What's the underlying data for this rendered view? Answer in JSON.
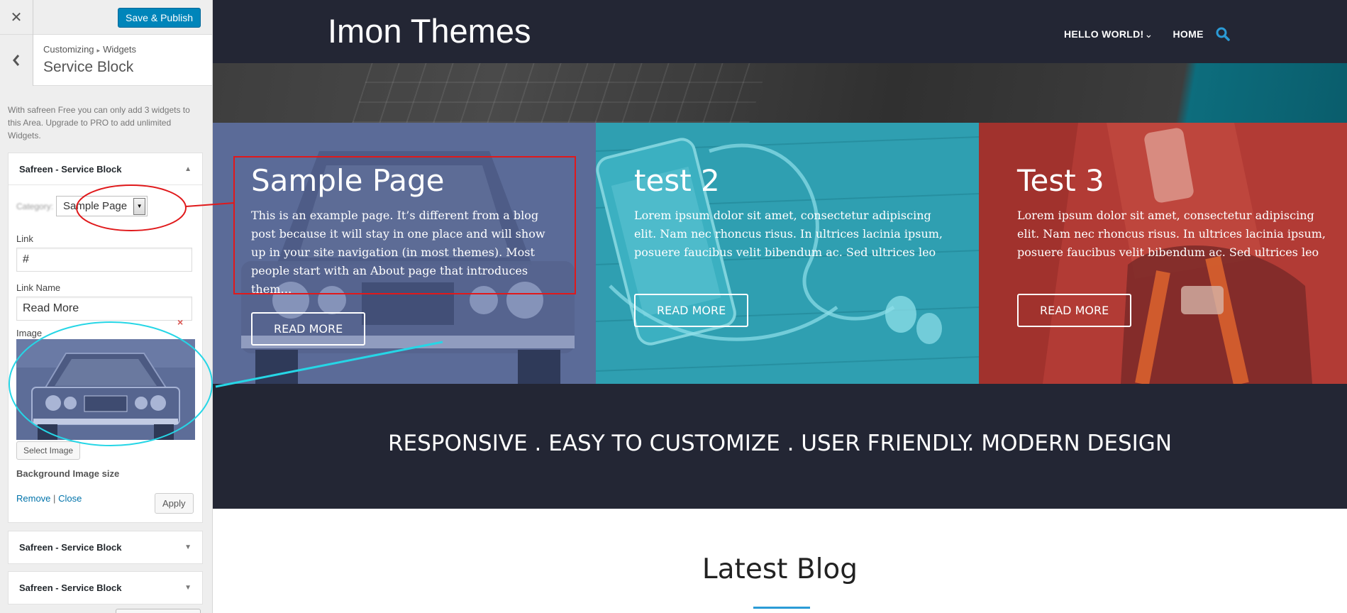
{
  "customizer": {
    "close_glyph": "✕",
    "save_publish": "Save & Publish",
    "back_glyph": "‹",
    "breadcrumb": {
      "root": "Customizing",
      "separator": "▸",
      "parent": "Widgets"
    },
    "section_title": "Service Block",
    "notice": "With safreen Free you can only add 3 widgets to this Area. Upgrade to PRO to add unlimited Widgets.",
    "widgets": [
      {
        "title": "Safreen - Service Block",
        "expanded": true
      },
      {
        "title": "Safreen - Service Block",
        "expanded": false
      },
      {
        "title": "Safreen - Service Block",
        "expanded": false
      }
    ],
    "form": {
      "category_label": "Category:",
      "category_value": "Sample Page",
      "link_label": "Link",
      "link_value": "#",
      "link_name_label": "Link Name",
      "link_name_value": "Read More",
      "image_label": "Image",
      "image_remove_glyph": "×",
      "select_image": "Select Image",
      "bg_size_label": "Background Image size",
      "remove": "Remove",
      "link_sep": "|",
      "close": "Close",
      "apply": "Apply"
    }
  },
  "site": {
    "title": "Imon Themes",
    "menu": {
      "hello": "HELLO WORLD!",
      "hello_caret": "⌄",
      "home": "HOME"
    },
    "colors": {
      "nav_bg": "#232634",
      "panel1": "#5a6a97",
      "panel2": "#2fa1b3",
      "panel3": "#b23a34",
      "accent": "#2b9bd6",
      "annotation_red": "#e0191b",
      "annotation_cyan": "#26d6e6"
    },
    "panels": [
      {
        "title": "Sample Page",
        "text": "This is an example page. It’s different from a blog post because it will stay in one place and will show up in your site navigation (in most themes). Most people start with an About page that introduces them…",
        "button": "READ MORE"
      },
      {
        "title": "test 2",
        "text": "Lorem ipsum dolor sit amet, consectetur adipiscing elit. Nam nec rhoncus risus. In ultrices lacinia ipsum, posuere faucibus velit bibendum ac. Sed ultrices leo",
        "button": "READ MORE"
      },
      {
        "title": "Test 3",
        "text": "Lorem ipsum dolor sit amet, consectetur adipiscing elit. Nam nec rhoncus risus. In ultrices lacinia ipsum, posuere faucibus velit bibendum ac. Sed ultrices leo",
        "button": "READ MORE"
      }
    ],
    "tagline": "RESPONSIVE . EASY TO CUSTOMIZE . USER FRIENDLY. MODERN DESIGN",
    "latest_blog": "Latest Blog"
  }
}
